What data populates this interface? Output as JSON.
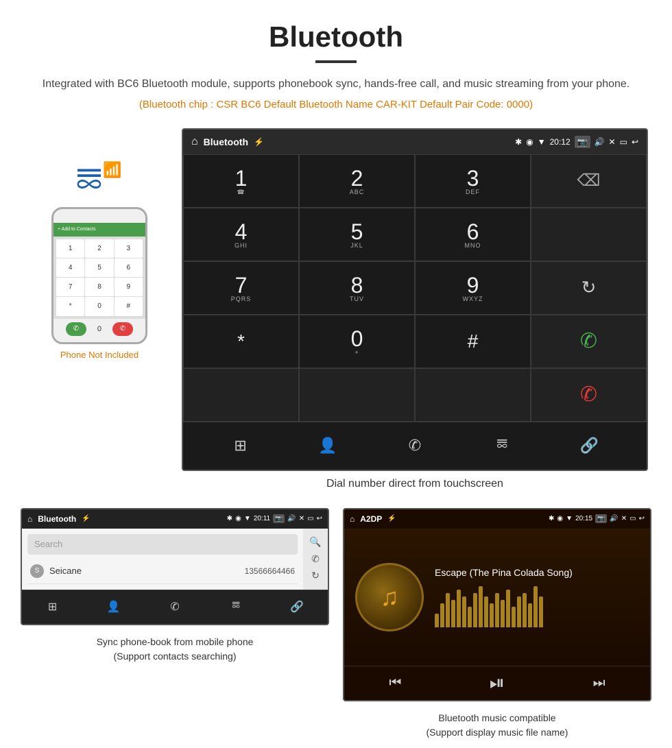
{
  "page": {
    "title": "Bluetooth",
    "description": "Integrated with BC6 Bluetooth module, supports phonebook sync, hands-free call, and music streaming from your phone.",
    "specs": "(Bluetooth chip : CSR BC6    Default Bluetooth Name CAR-KIT    Default Pair Code: 0000)",
    "caption_dial": "Dial number direct from touchscreen",
    "caption_phonebook": "Sync phone-book from mobile phone\n(Support contacts searching)",
    "caption_music": "Bluetooth music compatible\n(Support display music file name)"
  },
  "dial_screen": {
    "title": "Bluetooth",
    "time": "20:12",
    "keys": [
      {
        "main": "1",
        "sub": ""
      },
      {
        "main": "2",
        "sub": "ABC"
      },
      {
        "main": "3",
        "sub": "DEF"
      },
      {
        "main": "",
        "sub": "",
        "type": "backspace"
      },
      {
        "main": "4",
        "sub": "GHI"
      },
      {
        "main": "5",
        "sub": "JKL"
      },
      {
        "main": "6",
        "sub": "MNO"
      },
      {
        "main": "",
        "sub": "",
        "type": "empty"
      },
      {
        "main": "7",
        "sub": "PQRS"
      },
      {
        "main": "8",
        "sub": "TUV"
      },
      {
        "main": "9",
        "sub": "WXYZ"
      },
      {
        "main": "",
        "sub": "",
        "type": "refresh"
      },
      {
        "main": "*",
        "sub": ""
      },
      {
        "main": "0",
        "sub": "+"
      },
      {
        "main": "#",
        "sub": ""
      },
      {
        "main": "",
        "sub": "",
        "type": "call_green"
      },
      {
        "main": "",
        "sub": "",
        "type": "empty_bottom"
      },
      {
        "main": "",
        "sub": "",
        "type": "empty_bottom"
      },
      {
        "main": "",
        "sub": "",
        "type": "empty_bottom"
      },
      {
        "main": "",
        "sub": "",
        "type": "call_red"
      }
    ],
    "toolbar": [
      "grid",
      "person",
      "phone",
      "bluetooth",
      "link"
    ]
  },
  "phonebook_screen": {
    "title": "Bluetooth",
    "time": "20:11",
    "search_placeholder": "Search",
    "contacts": [
      {
        "letter": "S",
        "name": "Seicane",
        "phone": "13566664466"
      }
    ],
    "side_icons": [
      "search",
      "phone",
      "refresh"
    ],
    "toolbar": [
      "grid",
      "person",
      "phone",
      "bluetooth",
      "link"
    ]
  },
  "music_screen": {
    "title": "A2DP",
    "time": "20:15",
    "song_title": "Escape (The Pina Colada Song)",
    "viz_bars": [
      20,
      35,
      50,
      40,
      55,
      45,
      30,
      50,
      60,
      45,
      35,
      50,
      40,
      55,
      30,
      45,
      50,
      35,
      60,
      45
    ],
    "controls": [
      "prev",
      "play_pause",
      "next"
    ]
  },
  "phone_graphic": {
    "keys": [
      "1",
      "2",
      "3",
      "4",
      "5",
      "6",
      "7",
      "8",
      "9",
      "*",
      "0",
      "#"
    ]
  }
}
